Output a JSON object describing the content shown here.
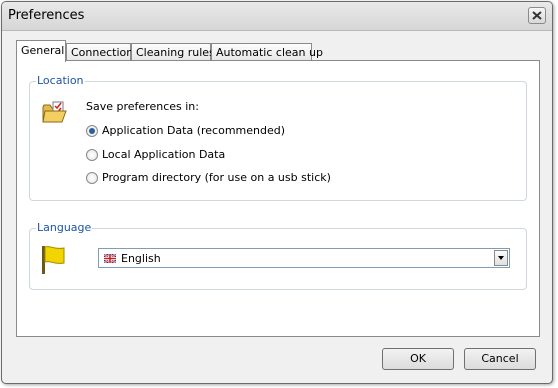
{
  "window": {
    "title": "Preferences"
  },
  "tabs": [
    {
      "label": "General",
      "active": true
    },
    {
      "label": "Connection",
      "active": false
    },
    {
      "label": "Cleaning rules",
      "active": false
    },
    {
      "label": "Automatic clean up",
      "active": false
    }
  ],
  "location": {
    "group_title": "Location",
    "prompt": "Save preferences in:",
    "options": [
      {
        "label": "Application Data (recommended)",
        "selected": true
      },
      {
        "label": "Local Application Data",
        "selected": false
      },
      {
        "label": "Program directory (for use on a usb stick)",
        "selected": false
      }
    ]
  },
  "language": {
    "group_title": "Language",
    "selected": "English"
  },
  "buttons": {
    "ok": "OK",
    "cancel": "Cancel"
  },
  "icons": {
    "close": "close-icon",
    "folder": "folder-checklist-icon",
    "flag": "yellow-flag-icon",
    "language_flag": "uk-flag-icon"
  },
  "colors": {
    "group_title": "#1e53a6",
    "flag_yellow": "#f2d400"
  }
}
